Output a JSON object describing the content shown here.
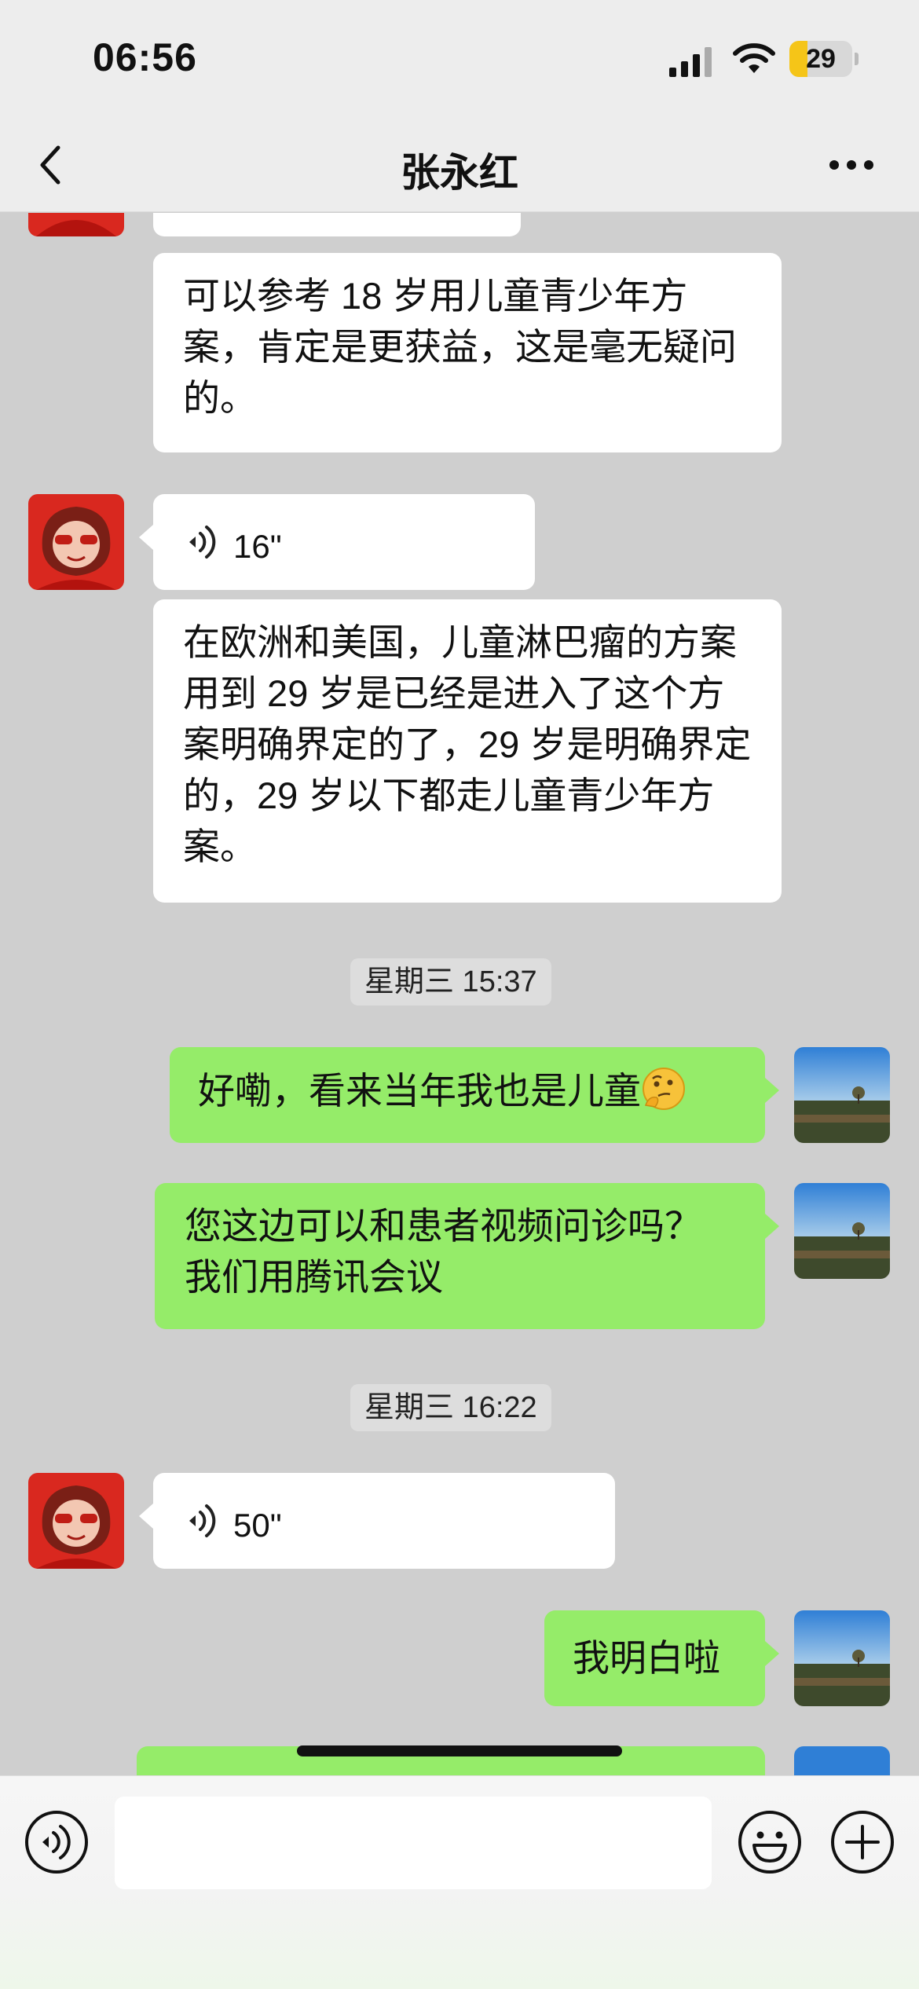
{
  "status_bar": {
    "time": "06:56",
    "battery": "29",
    "battery_level": 0.29
  },
  "header": {
    "title": "张永红"
  },
  "messages": {
    "m1": "可以参考 18 岁用儿童青少年方案，肯定是更获益，这是毫无疑问的。",
    "v1": "16\"",
    "m2": "在欧洲和美国，儿童淋巴瘤的方案用到 29 岁是已经是进入了这个方案明确界定的了，29 岁是明确界定的，29 岁以下都走儿童青少年方案。",
    "ts1": "星期三 15:37",
    "o1": "好嘞，看来当年我也是儿童",
    "o2": "您这边可以和患者视频问诊吗？我们用腾讯会议",
    "ts2": "星期三 16:22",
    "v2": "50\"",
    "o3": "我明白啦"
  },
  "colors": {
    "incoming": "#ffffff",
    "outgoing": "#95ec69",
    "background": "#cfcfcf"
  },
  "icons": [
    "back-icon",
    "more-icon",
    "voice-icon",
    "keyboard-voice-icon",
    "emoji-icon",
    "plus-icon",
    "thinking-face-emoji"
  ]
}
